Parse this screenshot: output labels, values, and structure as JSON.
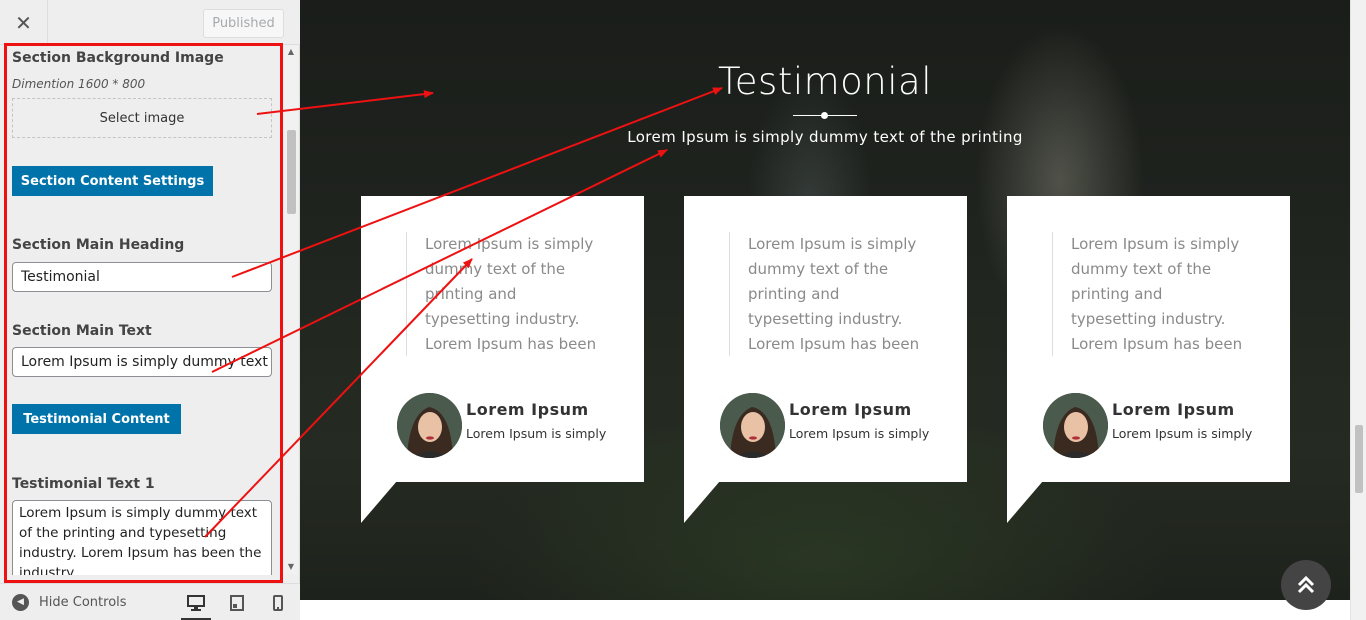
{
  "sidebar": {
    "close_icon": "close-icon",
    "publish_label": "Published",
    "section_bg_label": "Section Background Image",
    "section_bg_desc": "Dimention 1600 * 800",
    "select_image_label": "Select image",
    "content_settings_button": "Section Content Settings",
    "main_heading_label": "Section Main Heading",
    "main_heading_value": "Testimonial",
    "main_text_label": "Section Main Text",
    "main_text_value": "Lorem Ipsum is simply dummy text of the printing",
    "testimonial_content_button": "Testimonial Content",
    "testimonial_text_label": "Testimonial Text 1",
    "testimonial_text_value": "Lorem Ipsum is simply dummy text of the printing and typesetting industry. Lorem Ipsum has been the industry",
    "hide_controls_label": "Hide Controls"
  },
  "preview": {
    "title": "Testimonial",
    "subtitle": "Lorem Ipsum is simply dummy text of the printing",
    "cards": [
      {
        "quote": "Lorem Ipsum is simply dummy text of the printing and typesetting industry. Lorem Ipsum has been the industry",
        "name": "Lorem Ipsum",
        "role": "Lorem Ipsum is simply"
      },
      {
        "quote": "Lorem Ipsum is simply dummy text of the printing and typesetting industry. Lorem Ipsum has been the industry",
        "name": "Lorem Ipsum",
        "role": "Lorem Ipsum is simply"
      },
      {
        "quote": "Lorem Ipsum is simply dummy text of the printing and typesetting industry. Lorem Ipsum has been the industry",
        "name": "Lorem Ipsum",
        "role": "Lorem Ipsum is simply"
      }
    ]
  },
  "colors": {
    "accent_blue": "#0073aa",
    "annotation_red": "#ee1111"
  }
}
